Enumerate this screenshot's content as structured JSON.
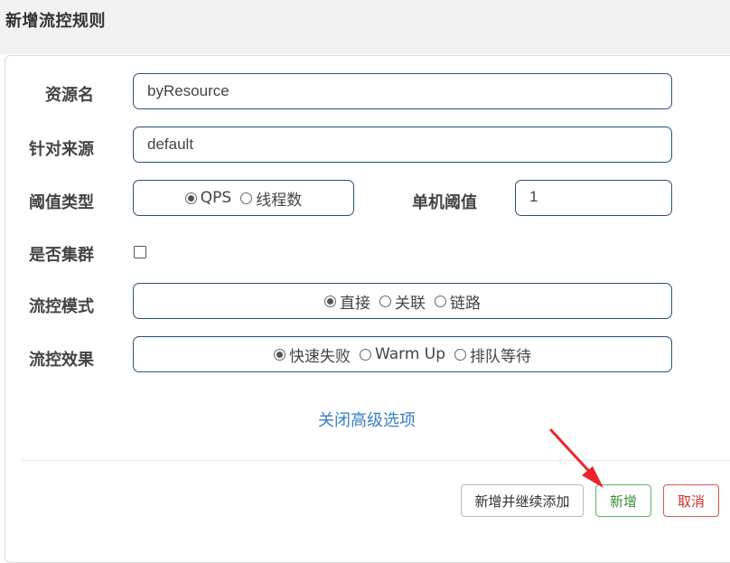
{
  "dialog": {
    "title": "新增流控规则"
  },
  "form": {
    "resource": {
      "label": "资源名",
      "value": "byResource"
    },
    "limit_app": {
      "label": "针对来源",
      "value": "default"
    },
    "grade": {
      "label": "阈值类型",
      "options": [
        "QPS",
        "线程数"
      ],
      "selected": "QPS"
    },
    "threshold": {
      "label": "单机阈值",
      "value": "1"
    },
    "cluster": {
      "label": "是否集群",
      "checked": false
    },
    "strategy": {
      "label": "流控模式",
      "options": [
        "直接",
        "关联",
        "链路"
      ],
      "selected": "直接"
    },
    "control_behavior": {
      "label": "流控效果",
      "options": [
        "快速失败",
        "Warm Up",
        "排队等待"
      ],
      "selected": "快速失败"
    },
    "toggle_advanced": "关闭高级选项"
  },
  "footer": {
    "add_continue_label": "新增并继续添加",
    "add_label": "新增",
    "cancel_label": "取消"
  },
  "colors": {
    "accent_link": "#3a7fc1",
    "add_green": "#5cb85c",
    "cancel_red": "#d9534f",
    "arrow_red": "#e8262b"
  }
}
